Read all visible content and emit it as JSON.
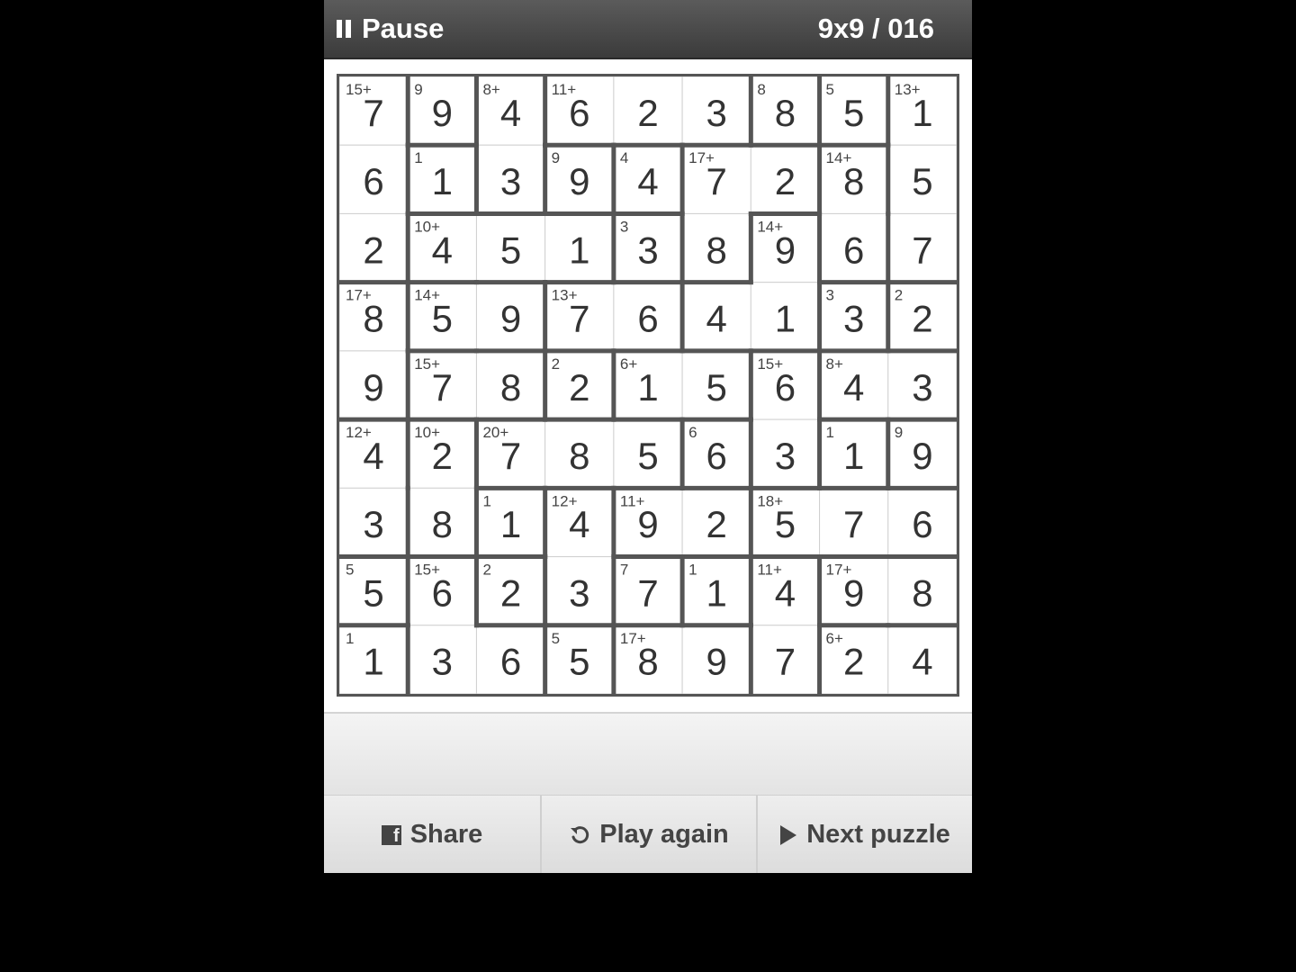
{
  "topbar": {
    "pause_label": "Pause",
    "puzzle_id": "9x9 / 016"
  },
  "board": {
    "size": 9,
    "values": [
      [
        7,
        9,
        4,
        6,
        2,
        3,
        8,
        5,
        1
      ],
      [
        6,
        1,
        3,
        9,
        4,
        7,
        2,
        8,
        5
      ],
      [
        2,
        4,
        5,
        1,
        3,
        8,
        9,
        6,
        7
      ],
      [
        8,
        5,
        9,
        7,
        6,
        4,
        1,
        3,
        2
      ],
      [
        9,
        7,
        8,
        2,
        1,
        5,
        6,
        4,
        3
      ],
      [
        4,
        2,
        7,
        8,
        5,
        6,
        3,
        1,
        9
      ],
      [
        3,
        8,
        1,
        4,
        9,
        2,
        5,
        7,
        6
      ],
      [
        5,
        6,
        2,
        3,
        7,
        1,
        4,
        9,
        8
      ],
      [
        1,
        3,
        6,
        5,
        8,
        9,
        7,
        2,
        4
      ]
    ],
    "cages": [
      {
        "clue": "15+",
        "cells": [
          [
            0,
            0
          ],
          [
            1,
            0
          ],
          [
            2,
            0
          ]
        ]
      },
      {
        "clue": "9",
        "cells": [
          [
            0,
            1
          ]
        ]
      },
      {
        "clue": "8+",
        "cells": [
          [
            0,
            2
          ],
          [
            1,
            2
          ]
        ]
      },
      {
        "clue": "11+",
        "cells": [
          [
            0,
            3
          ],
          [
            0,
            4
          ],
          [
            0,
            5
          ]
        ]
      },
      {
        "clue": "8",
        "cells": [
          [
            0,
            6
          ]
        ]
      },
      {
        "clue": "5",
        "cells": [
          [
            0,
            7
          ]
        ]
      },
      {
        "clue": "13+",
        "cells": [
          [
            0,
            8
          ],
          [
            1,
            8
          ],
          [
            2,
            8
          ]
        ]
      },
      {
        "clue": "1",
        "cells": [
          [
            1,
            1
          ]
        ]
      },
      {
        "clue": "9",
        "cells": [
          [
            1,
            3
          ]
        ]
      },
      {
        "clue": "4",
        "cells": [
          [
            1,
            4
          ]
        ]
      },
      {
        "clue": "17+",
        "cells": [
          [
            1,
            5
          ],
          [
            2,
            5
          ],
          [
            1,
            6
          ]
        ]
      },
      {
        "clue": "14+",
        "cells": [
          [
            1,
            7
          ],
          [
            2,
            7
          ]
        ]
      },
      {
        "clue": "10+",
        "cells": [
          [
            2,
            1
          ],
          [
            2,
            2
          ],
          [
            2,
            3
          ]
        ]
      },
      {
        "clue": "3",
        "cells": [
          [
            2,
            4
          ]
        ]
      },
      {
        "clue": "14+",
        "cells": [
          [
            2,
            6
          ],
          [
            3,
            6
          ],
          [
            3,
            5
          ]
        ]
      },
      {
        "clue": "17+",
        "cells": [
          [
            3,
            0
          ],
          [
            4,
            0
          ]
        ]
      },
      {
        "clue": "14+",
        "cells": [
          [
            3,
            1
          ],
          [
            3,
            2
          ]
        ]
      },
      {
        "clue": "13+",
        "cells": [
          [
            3,
            3
          ],
          [
            3,
            4
          ]
        ]
      },
      {
        "clue": "3",
        "cells": [
          [
            3,
            7
          ]
        ]
      },
      {
        "clue": "2",
        "cells": [
          [
            3,
            8
          ]
        ]
      },
      {
        "clue": "15+",
        "cells": [
          [
            4,
            1
          ],
          [
            4,
            2
          ]
        ]
      },
      {
        "clue": "2",
        "cells": [
          [
            4,
            3
          ]
        ]
      },
      {
        "clue": "6+",
        "cells": [
          [
            4,
            4
          ],
          [
            4,
            5
          ]
        ]
      },
      {
        "clue": "15+",
        "cells": [
          [
            4,
            6
          ],
          [
            5,
            6
          ]
        ]
      },
      {
        "clue": "8+",
        "cells": [
          [
            4,
            7
          ],
          [
            4,
            8
          ]
        ]
      },
      {
        "clue": "12+",
        "cells": [
          [
            5,
            0
          ],
          [
            6,
            0
          ]
        ]
      },
      {
        "clue": "10+",
        "cells": [
          [
            5,
            1
          ],
          [
            6,
            1
          ]
        ]
      },
      {
        "clue": "20+",
        "cells": [
          [
            5,
            2
          ],
          [
            5,
            3
          ],
          [
            5,
            4
          ]
        ]
      },
      {
        "clue": "6",
        "cells": [
          [
            5,
            5
          ]
        ]
      },
      {
        "clue": "1",
        "cells": [
          [
            5,
            7
          ]
        ]
      },
      {
        "clue": "9",
        "cells": [
          [
            5,
            8
          ]
        ]
      },
      {
        "clue": "1",
        "cells": [
          [
            6,
            2
          ]
        ]
      },
      {
        "clue": "12+",
        "cells": [
          [
            6,
            3
          ],
          [
            7,
            3
          ]
        ]
      },
      {
        "clue": "11+",
        "cells": [
          [
            6,
            4
          ],
          [
            6,
            5
          ]
        ]
      },
      {
        "clue": "18+",
        "cells": [
          [
            6,
            6
          ],
          [
            6,
            7
          ],
          [
            6,
            8
          ]
        ]
      },
      {
        "clue": "5",
        "cells": [
          [
            7,
            0
          ]
        ]
      },
      {
        "clue": "15+",
        "cells": [
          [
            7,
            1
          ],
          [
            8,
            1
          ],
          [
            8,
            2
          ]
        ]
      },
      {
        "clue": "2",
        "cells": [
          [
            7,
            2
          ]
        ]
      },
      {
        "clue": "7",
        "cells": [
          [
            7,
            4
          ]
        ]
      },
      {
        "clue": "1",
        "cells": [
          [
            7,
            5
          ]
        ]
      },
      {
        "clue": "11+",
        "cells": [
          [
            7,
            6
          ],
          [
            8,
            6
          ]
        ]
      },
      {
        "clue": "17+",
        "cells": [
          [
            7,
            7
          ],
          [
            7,
            8
          ]
        ]
      },
      {
        "clue": "1",
        "cells": [
          [
            8,
            0
          ]
        ]
      },
      {
        "clue": "5",
        "cells": [
          [
            8,
            3
          ]
        ]
      },
      {
        "clue": "17+",
        "cells": [
          [
            8,
            4
          ],
          [
            8,
            5
          ]
        ]
      },
      {
        "clue": "6+",
        "cells": [
          [
            8,
            7
          ],
          [
            8,
            8
          ]
        ]
      }
    ]
  },
  "bottombar": {
    "share_label": "Share",
    "play_again_label": "Play again",
    "next_label": "Next puzzle"
  },
  "colors": {
    "background": "#000000",
    "topbar": "#4a4a4a",
    "grid_line": "#555555",
    "cell": "#ffffff",
    "digit": "#333333"
  }
}
